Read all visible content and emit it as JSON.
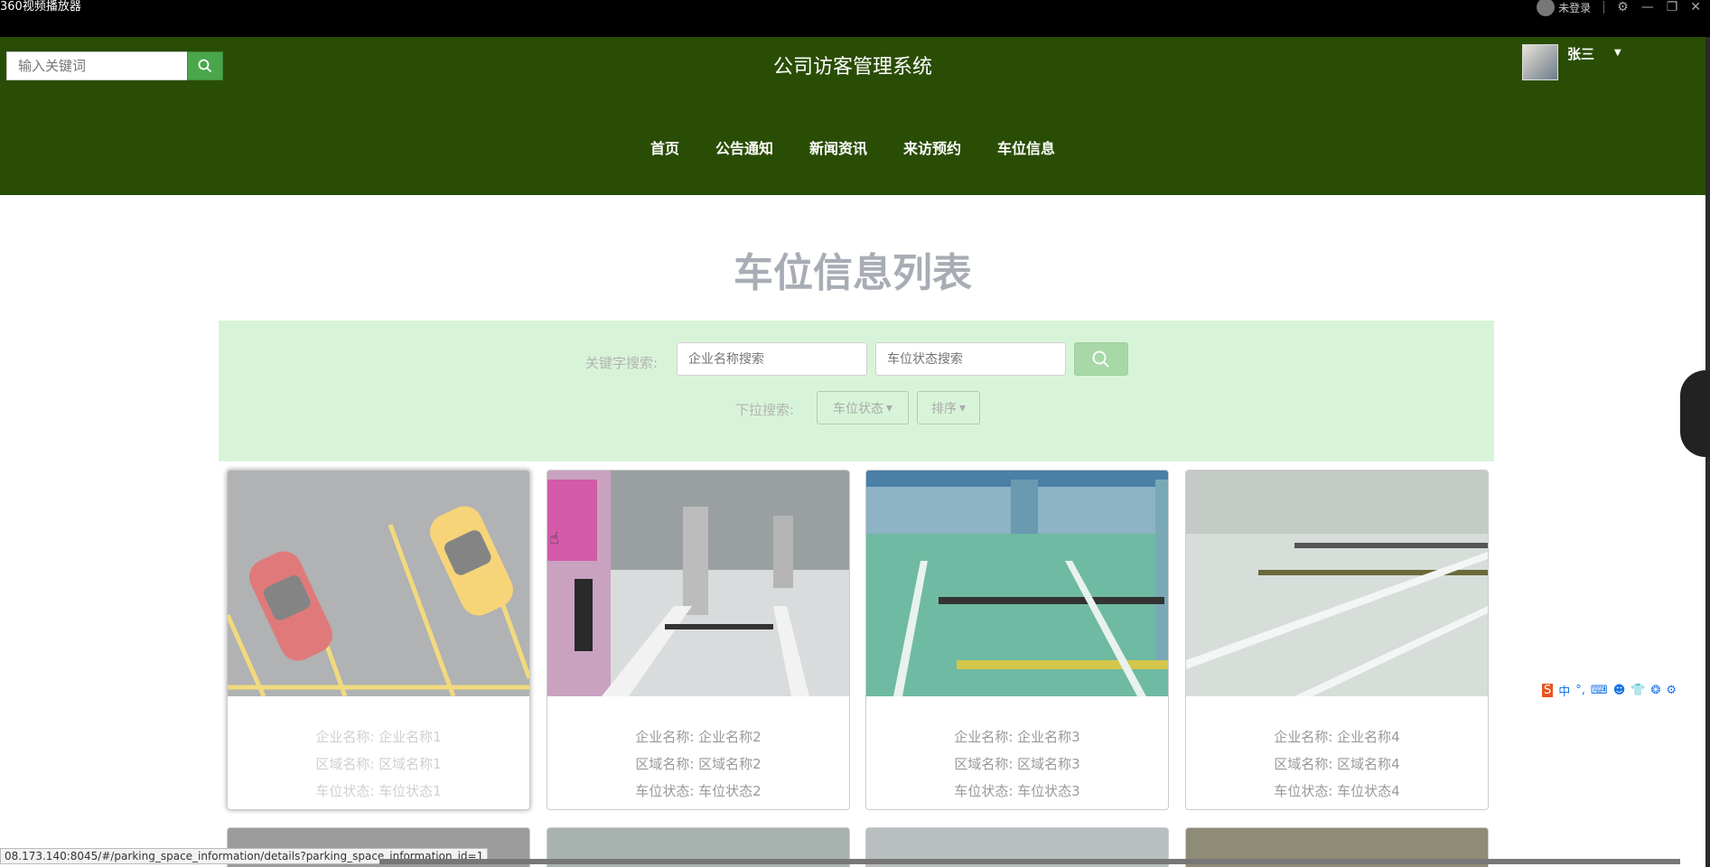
{
  "player": {
    "title": "360视频播放器",
    "login_label": "未登录"
  },
  "header": {
    "search_placeholder": "输入关键词",
    "site_title": "公司访客管理系统",
    "user_name": "张三"
  },
  "nav": [
    "首页",
    "公告通知",
    "新闻资讯",
    "来访预约",
    "车位信息"
  ],
  "page": {
    "heading": "车位信息列表"
  },
  "filter": {
    "keyword_label": "关键字搜索:",
    "company_placeholder": "企业名称搜索",
    "status_placeholder": "车位状态搜索",
    "dropdown_label": "下拉搜索:",
    "status_dropdown": "车位状态",
    "sort_dropdown": "排序"
  },
  "cards": [
    {
      "company": "企业名称: 企业名称1",
      "area": "区域名称: 区域名称1",
      "status": "车位状态: 车位状态1"
    },
    {
      "company": "企业名称: 企业名称2",
      "area": "区域名称: 区域名称2",
      "status": "车位状态: 车位状态2"
    },
    {
      "company": "企业名称: 企业名称3",
      "area": "区域名称: 区域名称3",
      "status": "车位状态: 车位状态3"
    },
    {
      "company": "企业名称: 企业名称4",
      "area": "区域名称: 区域名称4",
      "status": "车位状态: 车位状态4"
    }
  ],
  "ime": {
    "mode": "中"
  },
  "status_url": "08.173.140:8045/#/parking_space_information/details?parking_space_information_id=1",
  "colors": {
    "header_bg": "#2a4d06",
    "filter_bg": "#d8f4d8",
    "accent_green": "#4aa64a"
  }
}
